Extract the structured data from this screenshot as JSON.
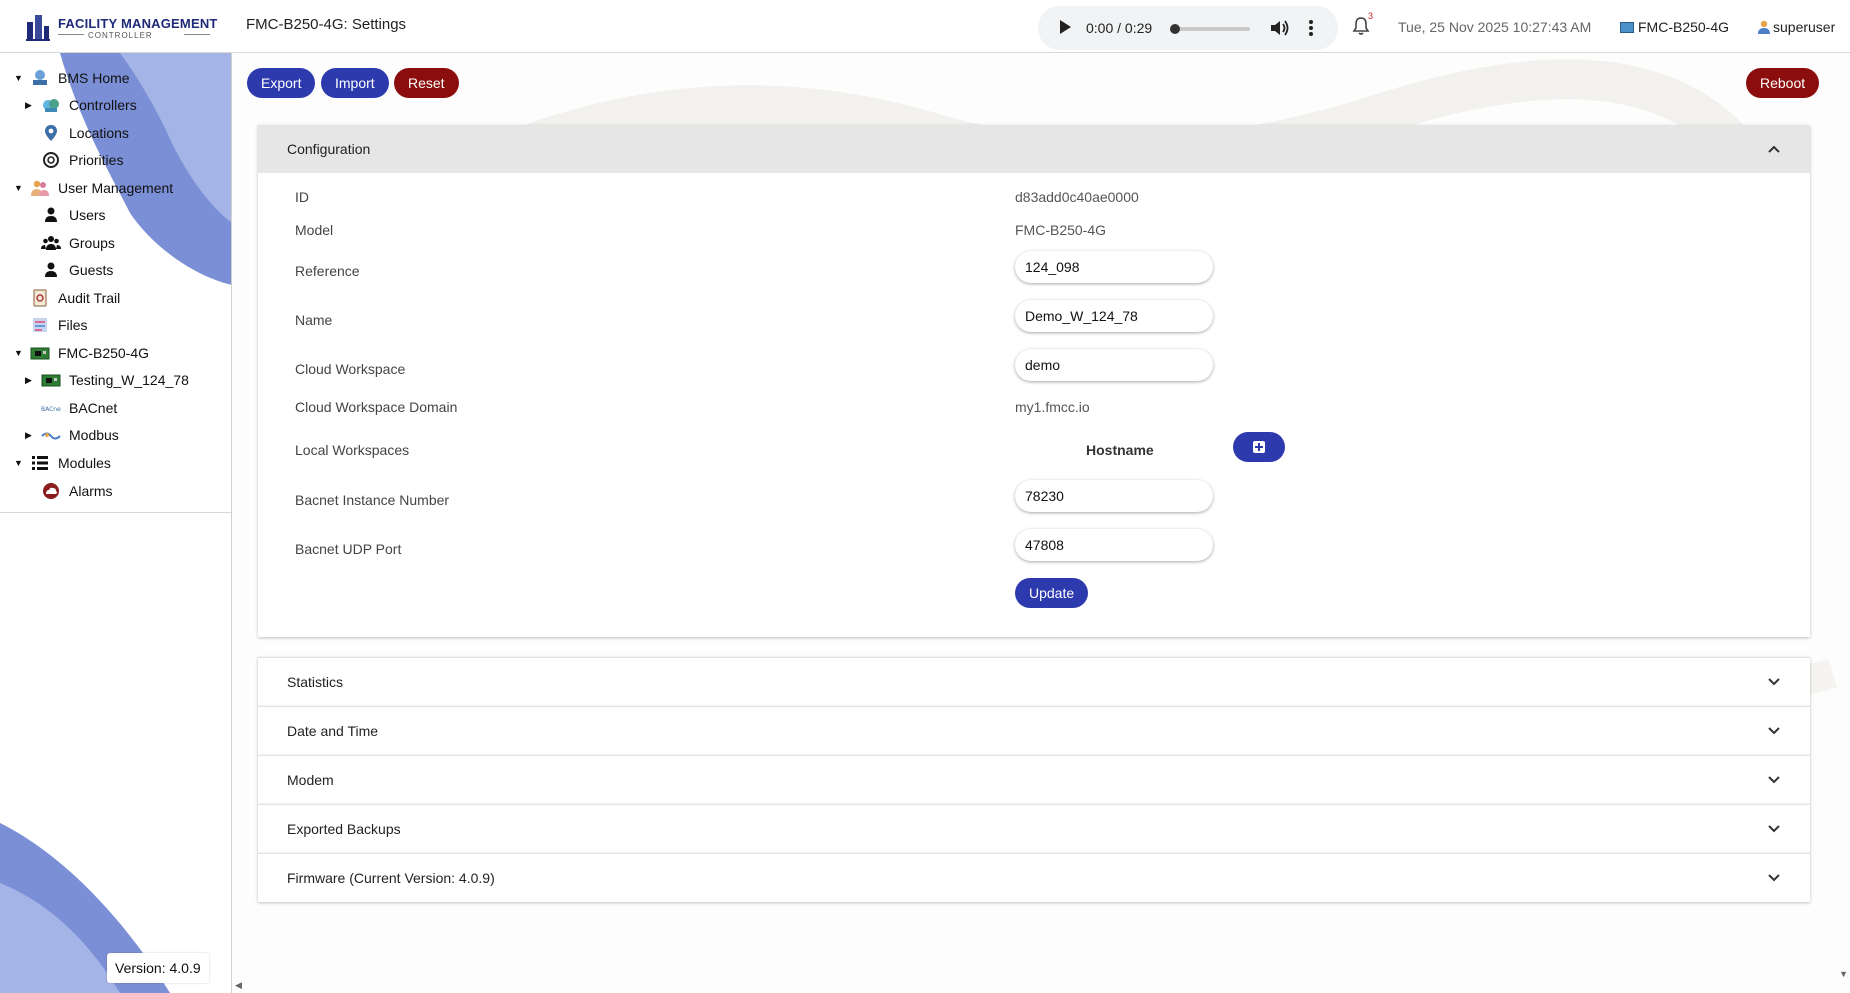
{
  "header": {
    "logo_text": "FACILITY MANAGEMENT",
    "logo_subtext": "CONTROLLER",
    "page_title": "FMC-B250-4G: Settings",
    "audio": {
      "time": "0:00 / 0:29",
      "progress": 0.0
    },
    "notifications_count": "3",
    "datetime": "Tue, 25 Nov 2025 10:27:43 AM",
    "device": "FMC-B250-4G",
    "user": "superuser"
  },
  "sidebar": {
    "items": [
      {
        "label": "BMS Home",
        "icon": "bms-home-icon",
        "caret": "▼"
      },
      {
        "label": "Controllers",
        "icon": "controllers-icon",
        "caret": "▶"
      },
      {
        "label": "Locations",
        "icon": "location-pin-icon",
        "caret": ""
      },
      {
        "label": "Priorities",
        "icon": "lifebuoy-icon",
        "caret": ""
      },
      {
        "label": "User Management",
        "icon": "users-group-icon",
        "caret": "▼"
      },
      {
        "label": "Users",
        "icon": "user-icon",
        "caret": ""
      },
      {
        "label": "Groups",
        "icon": "groups-icon",
        "caret": ""
      },
      {
        "label": "Guests",
        "icon": "guest-icon",
        "caret": ""
      },
      {
        "label": "Audit Trail",
        "icon": "audit-trail-icon",
        "caret": ""
      },
      {
        "label": "Files",
        "icon": "files-icon",
        "caret": ""
      },
      {
        "label": "FMC-B250-4G",
        "icon": "controller-board-icon",
        "caret": "▼"
      },
      {
        "label": "Testing_W_124_78",
        "icon": "controller-board-icon",
        "caret": "▶"
      },
      {
        "label": "BACnet",
        "icon": "bacnet-icon",
        "caret": ""
      },
      {
        "label": "Modbus",
        "icon": "modbus-icon",
        "caret": "▶"
      },
      {
        "label": "Modules",
        "icon": "modules-list-icon",
        "caret": "▼"
      },
      {
        "label": "Alarms",
        "icon": "alarm-cloud-icon",
        "caret": ""
      }
    ],
    "version": "Version: 4.0.9"
  },
  "toolbar": {
    "export_label": "Export",
    "import_label": "Import",
    "reset_label": "Reset",
    "reboot_label": "Reboot"
  },
  "configuration": {
    "title": "Configuration",
    "id_label": "ID",
    "id_value": "d83add0c40ae0000",
    "model_label": "Model",
    "model_value": "FMC-B250-4G",
    "reference_label": "Reference",
    "reference_value": "124_098",
    "name_label": "Name",
    "name_value": "Demo_W_124_78",
    "cloud_workspace_label": "Cloud Workspace",
    "cloud_workspace_value": "demo",
    "cloud_domain_label": "Cloud Workspace Domain",
    "cloud_domain_value": "my1.fmcc.io",
    "local_workspaces_label": "Local Workspaces",
    "hostname_header": "Hostname",
    "bacnet_instance_label": "Bacnet Instance Number",
    "bacnet_instance_value": "78230",
    "bacnet_port_label": "Bacnet UDP Port",
    "bacnet_port_value": "47808",
    "update_label": "Update"
  },
  "sections": [
    {
      "title": "Statistics"
    },
    {
      "title": "Date and Time"
    },
    {
      "title": "Modem"
    },
    {
      "title": "Exported Backups"
    },
    {
      "title": "Firmware (Current Version: 4.0.9)"
    }
  ],
  "colors": {
    "primary_blue": "#2d3aae",
    "danger_red": "#8b0d0d",
    "sidebar_wave": "#7b8fd6"
  }
}
